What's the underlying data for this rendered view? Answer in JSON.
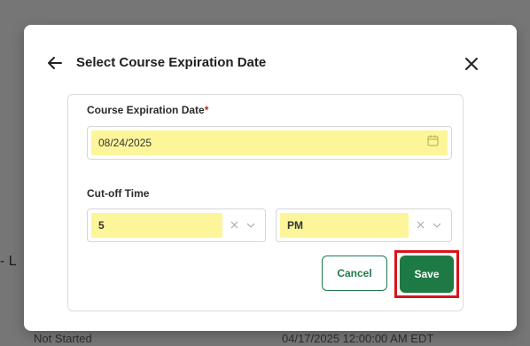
{
  "background": {
    "dash_text": "- L",
    "status_text": "Not Started",
    "date_text": "04/17/2025 12:00:00 AM EDT"
  },
  "modal": {
    "title": "Select Course Expiration Date",
    "back_icon": "arrow-left-icon",
    "close_icon": "close-x-icon"
  },
  "form": {
    "expiration_label": "Course Expiration Date",
    "required_mark": "*",
    "expiration_value": "08/24/2025",
    "calendar_icon": "calendar-icon",
    "cutoff_label": "Cut-off Time",
    "hour_value": "5",
    "ampm_value": "PM"
  },
  "actions": {
    "cancel_label": "Cancel",
    "save_label": "Save"
  },
  "colors": {
    "accent_green": "#1e7a44",
    "highlight_yellow": "#fdf59a",
    "required_red": "#d11a1a",
    "focus_frame_red": "#d8141b"
  }
}
